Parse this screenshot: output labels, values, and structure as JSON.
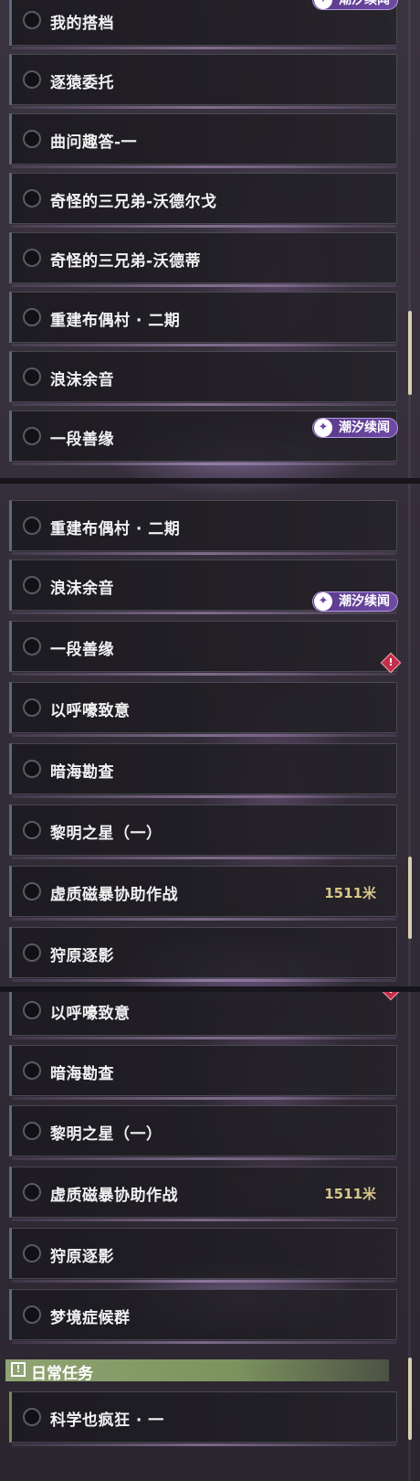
{
  "panel1": {
    "quests": [
      {
        "label": "我的搭档"
      },
      {
        "label": "逐猿委托"
      },
      {
        "label": "曲问趣答-一"
      },
      {
        "label": "奇怪的三兄弟-沃德尔戈"
      },
      {
        "label": "奇怪的三兄弟-沃德蒂"
      },
      {
        "label": "重建布偶村 · 二期"
      },
      {
        "label": "浪沫余音"
      },
      {
        "label": "一段善缘"
      }
    ],
    "badge_top": "潮汐续闻",
    "badge_bottom": "潮汐续闻"
  },
  "panel2": {
    "quests": [
      {
        "label": "重建布偶村 · 二期"
      },
      {
        "label": "浪沫余音"
      },
      {
        "label": "一段善缘"
      },
      {
        "label": "以呼嚎致意"
      },
      {
        "label": "暗海勘查"
      },
      {
        "label": "黎明之星（一）"
      },
      {
        "label": "虚质磁暴协助作战",
        "distance": "1511米"
      },
      {
        "label": "狩原逐影"
      }
    ],
    "badge": "潮汐续闻"
  },
  "panel3": {
    "quests": [
      {
        "label": "以呼嚎致意"
      },
      {
        "label": "暗海勘查"
      },
      {
        "label": "黎明之星（一）"
      },
      {
        "label": "虚质磁暴协助作战",
        "distance": "1511米"
      },
      {
        "label": "狩原逐影"
      },
      {
        "label": "梦境症候群"
      }
    ],
    "section": {
      "title": "日常任务",
      "icon": "!"
    },
    "daily": [
      {
        "label": "科学也疯狂 · 一"
      }
    ]
  },
  "colors": {
    "badge_purple": "#6e4aa6",
    "section_green": "#8fa472",
    "distance_gold": "#d8c68a",
    "alert_red": "#c0304a",
    "scrollbar": "#d9cfb0"
  },
  "icons": {
    "badge": "spiral-icon",
    "alert": "alert-diamond-icon",
    "section": "exclamation-box-icon",
    "radio": "radio-circle-icon"
  }
}
